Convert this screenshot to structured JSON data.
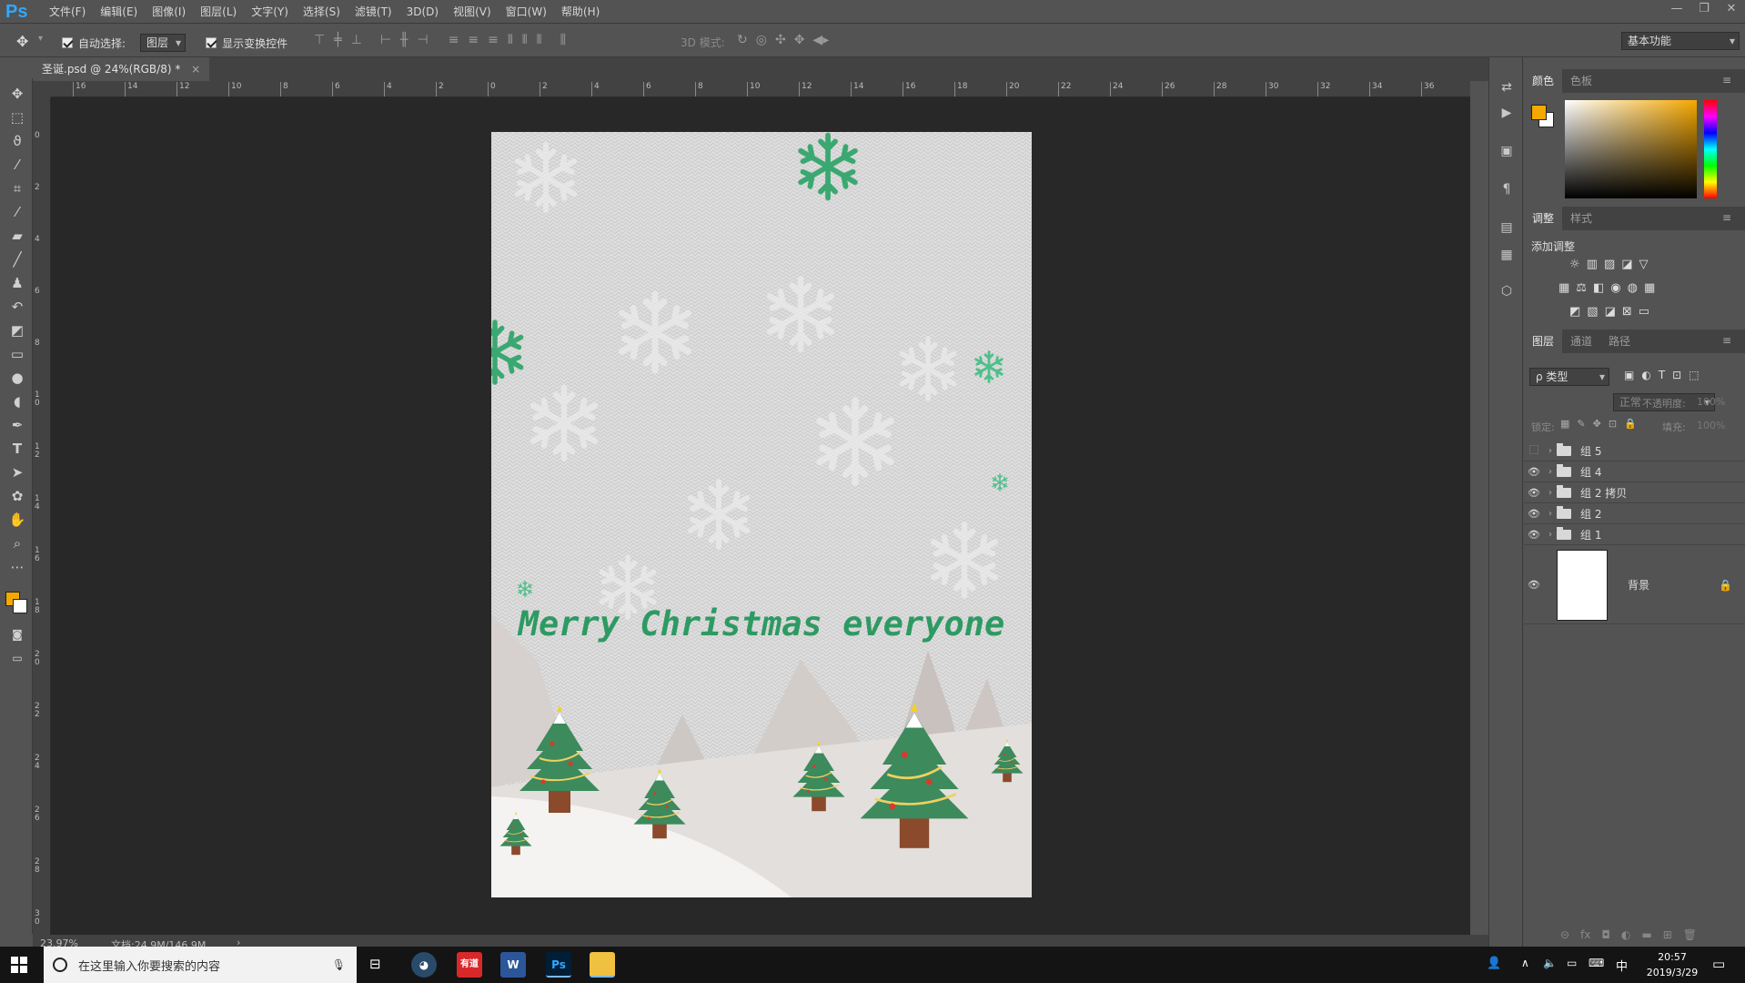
{
  "app": {
    "logo": "Ps"
  },
  "menu": [
    "文件(F)",
    "编辑(E)",
    "图像(I)",
    "图层(L)",
    "文字(Y)",
    "选择(S)",
    "滤镜(T)",
    "3D(D)",
    "视图(V)",
    "窗口(W)",
    "帮助(H)"
  ],
  "window_controls": [
    "—",
    "❐",
    "✕"
  ],
  "options": {
    "auto_select_label": "自动选择:",
    "auto_select_value": "图层",
    "show_transform_label": "显示变换控件",
    "mode_3d_label": "3D 模式:",
    "workspace": "基本功能"
  },
  "document": {
    "tab_title": "圣诞.psd @ 24%(RGB/8) *",
    "tab_close": "×"
  },
  "ruler_top": [
    "16",
    "14",
    "12",
    "10",
    "8",
    "6",
    "4",
    "2",
    "0",
    "2",
    "4",
    "6",
    "8",
    "10",
    "12",
    "14",
    "16",
    "18",
    "20",
    "22",
    "24",
    "26",
    "28",
    "30",
    "32",
    "34",
    "36"
  ],
  "ruler_left": [
    "0",
    "2",
    "4",
    "6",
    "8",
    "1 0",
    "1 2",
    "1 4",
    "1 6",
    "1 8",
    "2 0",
    "2 2",
    "2 4",
    "2 6",
    "2 8",
    "3 0"
  ],
  "artwork": {
    "headline": "Merry Christmas everyone"
  },
  "status": {
    "zoom": "23.97%",
    "doc_info": "文档:24.9M/146.9M",
    "arrow": "›"
  },
  "colors": {
    "foreground": "#f5a800",
    "background": "#ffffff",
    "text_green": "#2e9a63",
    "tree_green": "#3d8a5c",
    "trunk": "#8b4a2b"
  },
  "panels": {
    "color_tabs": [
      "颜色",
      "色板"
    ],
    "adjust_tabs": [
      "调整",
      "样式"
    ],
    "adjust_add": "添加调整",
    "layers_tabs": [
      "图层",
      "通道",
      "路径"
    ],
    "layer_filter": "ρ 类型",
    "blend_mode": "正常",
    "opacity_label": "不透明度:",
    "opacity_value": "100%",
    "lock_label": "锁定:",
    "fill_label": "填充:",
    "fill_value": "100%",
    "layers": [
      {
        "name": "组 5",
        "visible": false
      },
      {
        "name": "组 4",
        "visible": true
      },
      {
        "name": "组 2 拷贝",
        "visible": true
      },
      {
        "name": "组 2",
        "visible": true
      },
      {
        "name": "组 1",
        "visible": true
      }
    ],
    "background_layer": "背景"
  },
  "taskbar": {
    "search_placeholder": "在这里输入你要搜索的内容",
    "time": "20:57",
    "date": "2019/3/29",
    "ime": "中",
    "app_labels": [
      "有道",
      "W",
      "Ps"
    ]
  }
}
